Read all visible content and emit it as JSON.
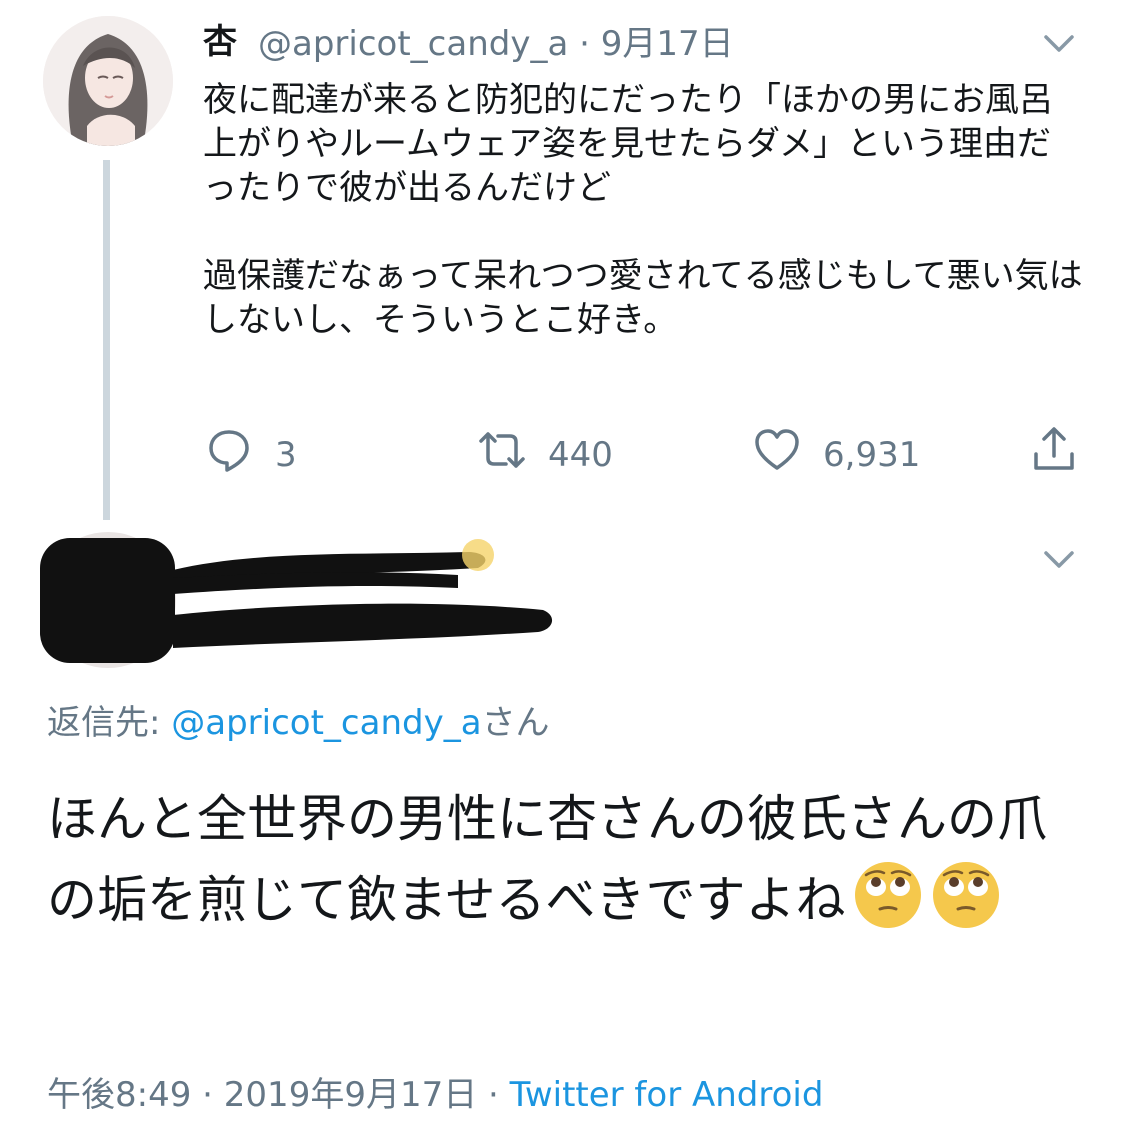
{
  "parent_tweet": {
    "author_name": "杏",
    "handle": "@apricot_candy_a",
    "separator": "·",
    "date": "9月17日",
    "text": "夜に配達が来ると防犯的にだったり「ほかの男にお風呂上がりやルームウェア姿を見せたらダメ」という理由だったりで彼が出るんだけど\n\n過保護だなぁって呆れつつ愛されてる感じもして悪い気はしないし、そういうとこ好き。",
    "counts": {
      "replies": "3",
      "retweets": "440",
      "likes": "6,931"
    }
  },
  "reply": {
    "replying_label": "返信先: ",
    "replying_handle": "@apricot_candy_a",
    "replying_suffix": "さん",
    "text": "ほんと全世界の男性に杏さんの彼氏さんの爪の垢を煎じて飲ませるべきですよね",
    "emojis": [
      "face-with-rolling-eyes-icon",
      "face-with-rolling-eyes-icon"
    ],
    "time": "午後8:49",
    "dot": " · ",
    "date": "2019年9月17日",
    "source": "Twitter for Android"
  },
  "colors": {
    "link": "#1b95e0",
    "muted": "#657786",
    "text": "#14171a",
    "thread": "#ccd6dd"
  }
}
